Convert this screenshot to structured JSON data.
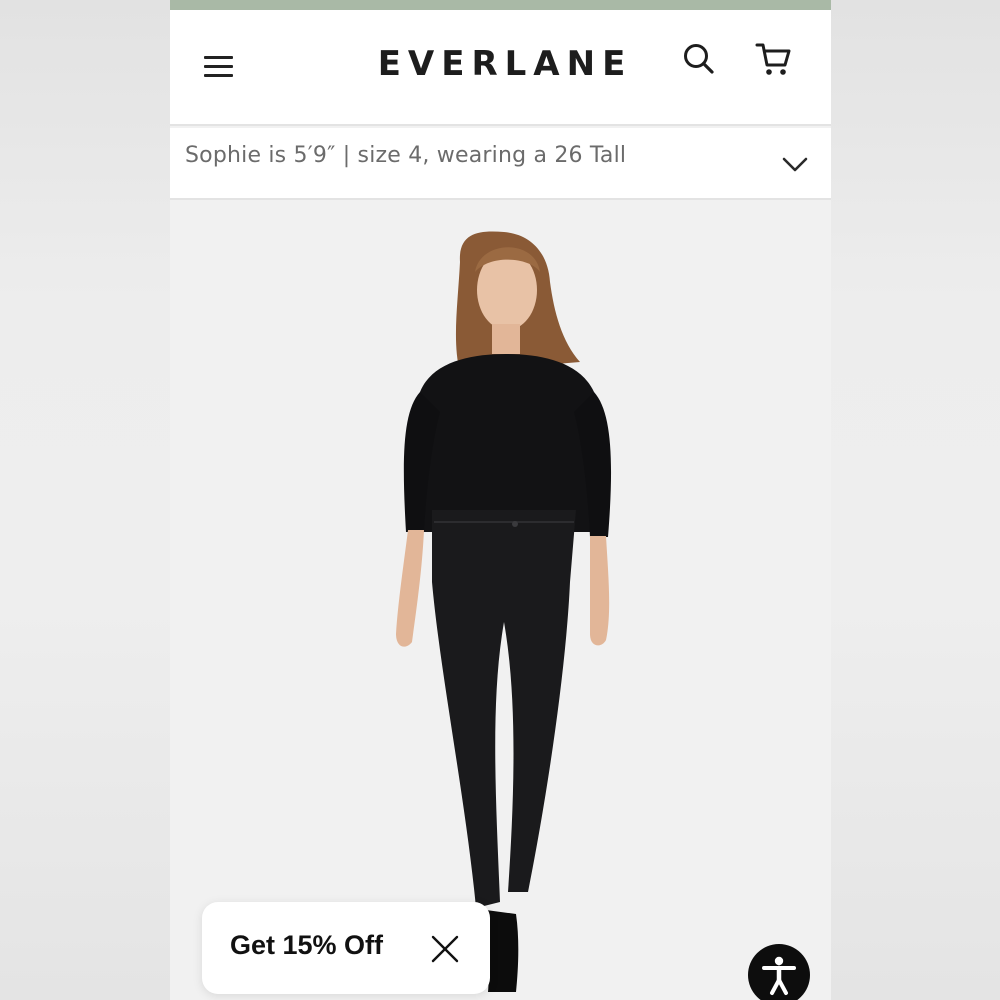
{
  "header": {
    "logo": "EVERLANE",
    "menu_icon": "hamburger-menu-icon",
    "search_icon": "search-icon",
    "cart_icon": "shopping-cart-icon",
    "accent_strip_color": "#a9b9a6"
  },
  "fit_info": {
    "text": "Sophie is 5′9″ | size 4, wearing a 26 Tall",
    "expand_icon": "chevron-down-icon"
  },
  "product_image": {
    "alt": "Model wearing black sweatshirt and black high-rise skinny jeans"
  },
  "promo": {
    "label": "Get 15% Off",
    "close_icon": "close-icon"
  },
  "accessibility": {
    "icon": "accessibility-icon"
  }
}
